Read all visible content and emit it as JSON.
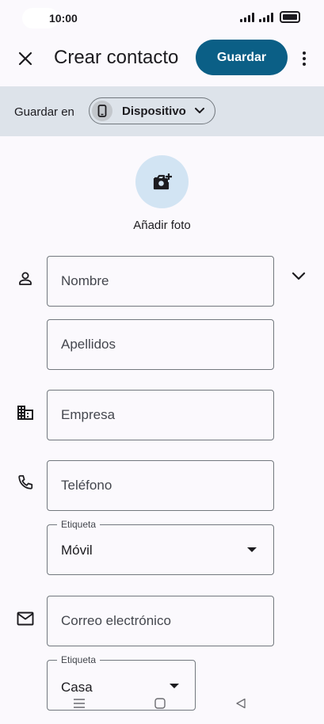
{
  "status": {
    "time": "10:00"
  },
  "header": {
    "title": "Crear contacto",
    "save_label": "Guardar"
  },
  "save_in": {
    "label": "Guardar en",
    "device_label": "Dispositivo"
  },
  "photo": {
    "label": "Añadir foto"
  },
  "fields": {
    "first_name_placeholder": "Nombre",
    "last_name_placeholder": "Apellidos",
    "company_placeholder": "Empresa",
    "phone_placeholder": "Teléfono",
    "phone_label_caption": "Etiqueta",
    "phone_label_value": "Móvil",
    "email_placeholder": "Correo electrónico",
    "email_label_caption": "Etiqueta",
    "email_label_value": "Casa"
  },
  "icons": {
    "close": "close-icon",
    "more": "more-vert-icon",
    "device": "phone-device-icon",
    "chip_chevron": "chevron-down-icon",
    "add_photo": "add-photo-icon",
    "person": "person-icon",
    "expand": "chevron-down-icon",
    "company": "business-icon",
    "phone": "phone-icon",
    "email": "mail-icon",
    "nav_menu": "menu-icon",
    "nav_home": "home-icon",
    "nav_back": "back-icon"
  },
  "colors": {
    "accent": "#0b5f86",
    "banner": "#dde3ea",
    "photo_bg": "#d2e4f3"
  }
}
